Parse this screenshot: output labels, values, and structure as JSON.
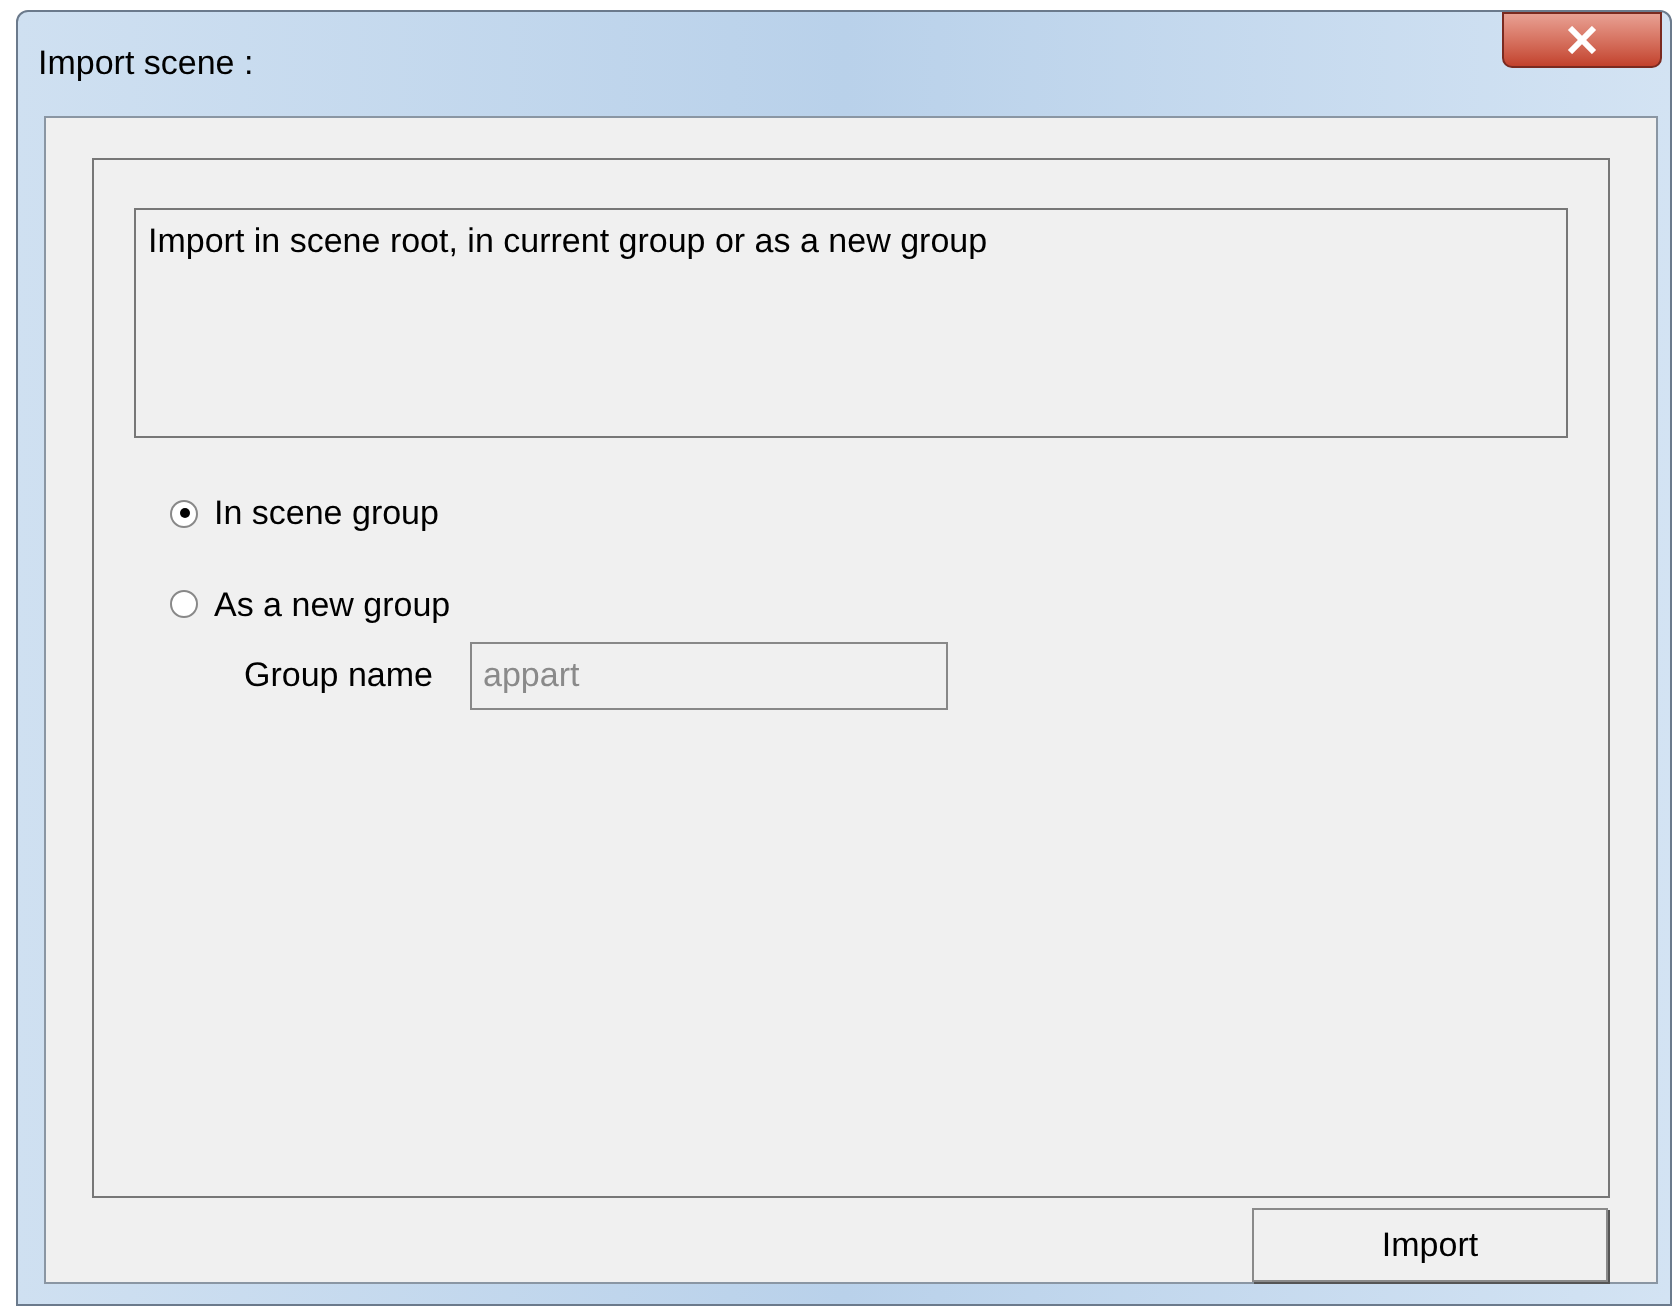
{
  "window": {
    "title": "Import scene :"
  },
  "description": "Import in scene root, in current group or as a new group",
  "options": [
    {
      "label": "In scene group",
      "selected": true
    },
    {
      "label": "As a new group",
      "selected": false
    }
  ],
  "group_name": {
    "label": "Group name",
    "value": "appart",
    "disabled": true
  },
  "buttons": [
    "Import"
  ]
}
